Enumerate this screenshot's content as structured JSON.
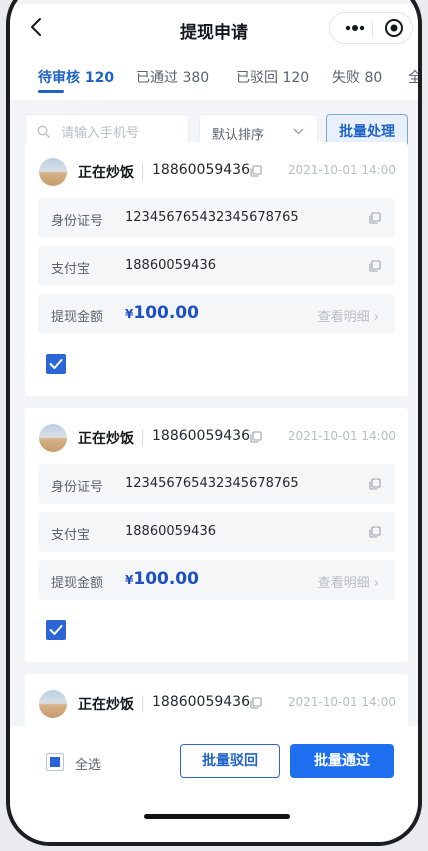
{
  "header": {
    "title": "提现申请"
  },
  "tabs": [
    {
      "label": "待审核 120",
      "active": true
    },
    {
      "label": "已通过 380",
      "active": false
    },
    {
      "label": "已驳回 120",
      "active": false
    },
    {
      "label": "失败 80",
      "active": false
    },
    {
      "label": "全",
      "active": false
    }
  ],
  "filter": {
    "search_placeholder": "请输入手机号",
    "sort_label": "默认排序",
    "batch_label": "批量处理"
  },
  "records": [
    {
      "name": "正在炒饭",
      "phone": "18860059436",
      "datetime": "2021-10-01 14:00",
      "id_label": "身份证号",
      "id_value": "12345676543234567876​5",
      "alipay_label": "支付宝",
      "alipay_value": "18860059436",
      "amount_label": "提现金额",
      "amount_currency": "¥",
      "amount_value": "100.00",
      "detail_label": "查看明细 ›",
      "checked": true
    },
    {
      "name": "正在炒饭",
      "phone": "18860059436",
      "datetime": "2021-10-01 14:00",
      "id_label": "身份证号",
      "id_value": "123456765432345678765",
      "alipay_label": "支付宝",
      "alipay_value": "18860059436",
      "amount_label": "提现金额",
      "amount_currency": "¥",
      "amount_value": "100.00",
      "detail_label": "查看明细 ›",
      "checked": true
    },
    {
      "name": "正在炒饭",
      "phone": "18860059436",
      "datetime": "2021-10-01 14:00"
    }
  ],
  "footer": {
    "select_all_label": "全选",
    "reject_label": "批量驳回",
    "approve_label": "批量通过"
  },
  "colors": {
    "accent": "#1f63c8",
    "primary_button": "#1e6ff0",
    "amount": "#1f4fc4"
  }
}
